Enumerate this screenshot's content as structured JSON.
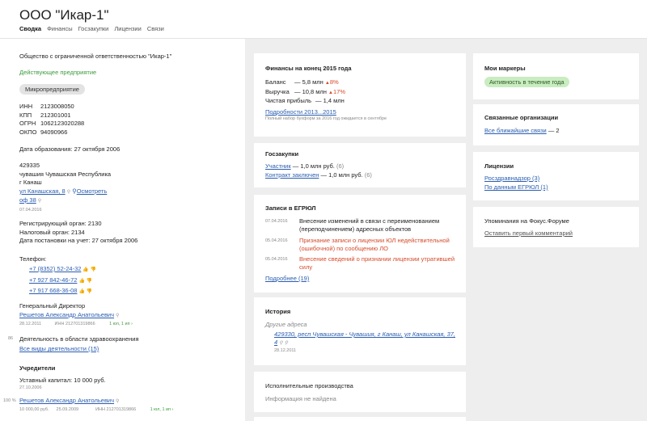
{
  "header": {
    "company": "ООО \"Икар-1\"",
    "tabs": [
      "Сводка",
      "Финансы",
      "Госзакупки",
      "Лицензии",
      "Связи"
    ]
  },
  "left": {
    "fullname": "Общество с ограниченной ответственностью \"Икар-1\"",
    "status": "Действующее предприятие",
    "badge": "Микропредприятие",
    "ids": [
      {
        "k": "ИНН",
        "v": "2123008050"
      },
      {
        "k": "КПП",
        "v": "212301001"
      },
      {
        "k": "ОГРН",
        "v": "1062123020288"
      },
      {
        "k": "ОКПО",
        "v": "94090966"
      }
    ],
    "founded": "Дата образования: 27 октября 2006",
    "addr_index": "429335",
    "addr_region": "чувашия Чувашская Республика",
    "addr_city": "г Канаш",
    "addr_street": "ул Канашская, 8",
    "addr_view": "Осмотреть",
    "addr_office": "оф 38",
    "addr_date": "07.04.2016",
    "reg_organ": "Регистрирующий орган: 2130",
    "tax_organ": "Налоговый орган: 2134",
    "tax_date": "Дата постановки на учет: 27 октября 2006",
    "phones_label": "Телефон:",
    "phones": [
      "+7 (8352) 52-24-32",
      "+7 927 842-46-72",
      "+7 917 668-36-08"
    ],
    "director_label": "Генеральный Директор",
    "director_name": "Решетов Александр Анатольевич",
    "director_date": "28.12.2011",
    "director_inn": "ИНН 212701319866",
    "director_links": "1 юл, 1 ип",
    "okved_code": "86",
    "okved_text": "Деятельность в области здравоохранения",
    "okved_link": "Все виды деятельности (15)",
    "founders_label": "Учредители",
    "capital": "Уставный капитал: 10 000 руб.",
    "capital_date": "27.10.2006",
    "founder_share": "100 %",
    "founder_name": "Решетов Александр Анатольевич",
    "founder_sum": "10 000,00 руб.",
    "founder_date": "25.09.2009",
    "founder_inn": "ИНН 212701319866",
    "founder_links": "1 юл, 1 ип"
  },
  "fin": {
    "title": "Финансы на конец 2015 года",
    "rows": [
      {
        "label": "Баланс",
        "val": "5,8 млн",
        "chg": "8%"
      },
      {
        "label": "Выручка",
        "val": "10,8 млн",
        "chg": "17%"
      },
      {
        "label": "Чистая прибыль",
        "val": "1,4 млн",
        "chg": ""
      }
    ],
    "link": "Подробности 2013...2015",
    "note": "Полный набор бухформ за 2016 год ожидается в сентябре"
  },
  "gz": {
    "title": "Госзакупки",
    "rows": [
      {
        "link": "Участник",
        "text": "— 1,0 млн руб.",
        "cnt": "(6)"
      },
      {
        "link": "Контракт заключен",
        "text": "— 1,0 млн руб.",
        "cnt": "(6)"
      }
    ]
  },
  "egr": {
    "title": "Записи в ЕГРЮЛ",
    "items": [
      {
        "date": "07.04.2016",
        "text": "Внесение изменений в связи с переименованием (переподчинением) адресных объектов",
        "red": false
      },
      {
        "date": "05.04.2016",
        "text": "Признание записи о лицензии ЮЛ недействительной (ошибочной) по сообщению ЛО",
        "red": true
      },
      {
        "date": "05.04.2016",
        "text": "Внесение сведений о признании лицензии утратившей силу",
        "red": true
      }
    ],
    "more": "Подробнее (19)"
  },
  "hist": {
    "title": "История",
    "sub": "Другие адреса",
    "addr": "429330, респ Чувашская - Чувашия, г Канаш, ул Канашская, 37, 4",
    "date": "28.12.2011"
  },
  "ip": {
    "title": "Исполнительные производства",
    "text": "Информация не найдена"
  },
  "markers": {
    "title": "Мои маркеры",
    "badge": "Активность в течение года"
  },
  "related": {
    "title": "Связанные организации",
    "link": "Все ближайшие связи",
    "count": "— 2"
  },
  "lic": {
    "title": "Лицензии",
    "items": [
      "Росздравнадзор (3)",
      "По данным ЕГРЮЛ (1)"
    ]
  },
  "forum": {
    "title": "Упоминания на Фокус.Форуме",
    "link": "Оставить первый комментарий"
  },
  "colors": {
    "link": "#2a5db0",
    "green": "#3b9a3b",
    "red": "#d64a2a",
    "bg_grey": "#eeeeee"
  }
}
